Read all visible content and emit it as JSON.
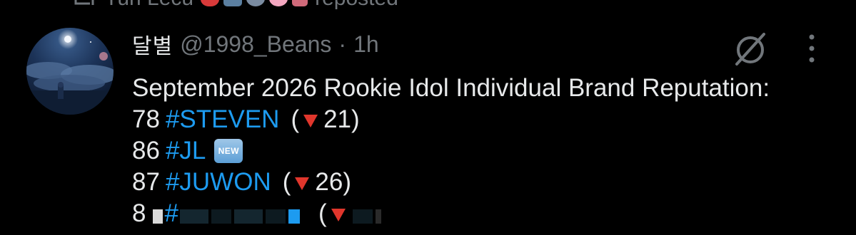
{
  "repost": {
    "user_name": "Yun Lecu",
    "label": "reposted",
    "icons": [
      "repost-icon",
      "strawberry-emoji",
      "box-emoji",
      "peace-emoji",
      "flower-emoji",
      "flag-emoji"
    ]
  },
  "tweet": {
    "display_name": "달별",
    "handle": "@1998_Beans",
    "separator": "·",
    "time": "1h",
    "text_line1": "September 2026 Rookie Idol Individual Brand Reputation:",
    "ranks": [
      {
        "rank": "78",
        "hashtag": "#STEVEN",
        "open": "(",
        "change": "21",
        "close": ")",
        "direction": "down"
      },
      {
        "rank": "86",
        "hashtag": "#JL",
        "badge": "NEW"
      },
      {
        "rank": "87",
        "hashtag": "#JUWON",
        "open": "(",
        "change": "26",
        "close": ")",
        "direction": "down"
      },
      {
        "rank": "8",
        "hashtag": "#",
        "open": "(",
        "censored": true
      }
    ]
  },
  "icons": {
    "grok": "grok-icon",
    "more": "more-options-icon"
  },
  "colors": {
    "background": "#000000",
    "text": "#e7e9ea",
    "muted": "#71767b",
    "hashtag": "#1d9bf0",
    "down_triangle": "#e0362c"
  }
}
